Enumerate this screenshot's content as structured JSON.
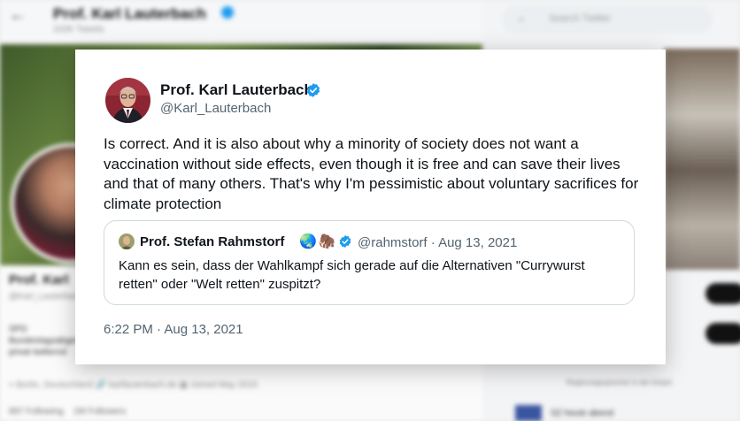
{
  "background": {
    "header_name": "Prof. Karl Lauterbach",
    "header_tweets": "102K Tweets",
    "search_placeholder": "Search Twitter",
    "profile_name": "Prof. Karl",
    "profile_handle": "@Karl_Lauterbach",
    "bio": "SPD Bundestagsabgeordneter, privat twitternd",
    "location": "Berlin, Deutschland",
    "website": "karllauterbach.de",
    "joined": "Joined May 2015",
    "following": "897 Following",
    "followers": "1M Followers",
    "side_text": "Regierungssprecher in der Ampel",
    "trend": "SZ heute abend"
  },
  "tweet": {
    "author_name": "Prof. Karl Lauterbach",
    "author_handle": "@Karl_Lauterbach",
    "text": "Is correct. And it is also about why a minority of society does not want a vaccination without side effects, even though it is free and can save their lives and that of many others. That's why I'm pessimistic about voluntary sacrifices for climate protection",
    "timestamp": "6:22 PM · Aug 13, 2021"
  },
  "quoted": {
    "author_name": "Prof. Stefan Rahmstorf",
    "emoji_1": "🌏",
    "emoji_2": "🦣",
    "handle_date": "@rahmstorf · Aug 13, 2021",
    "text": "Kann es sein, dass der Wahlkampf sich gerade auf die Alternativen \"Currywurst retten\" oder \"Welt retten\" zuspitzt?"
  },
  "colors": {
    "verified": "#1d9bf0",
    "text_primary": "#0f1419",
    "text_secondary": "#536471",
    "border": "#cfd9de"
  }
}
